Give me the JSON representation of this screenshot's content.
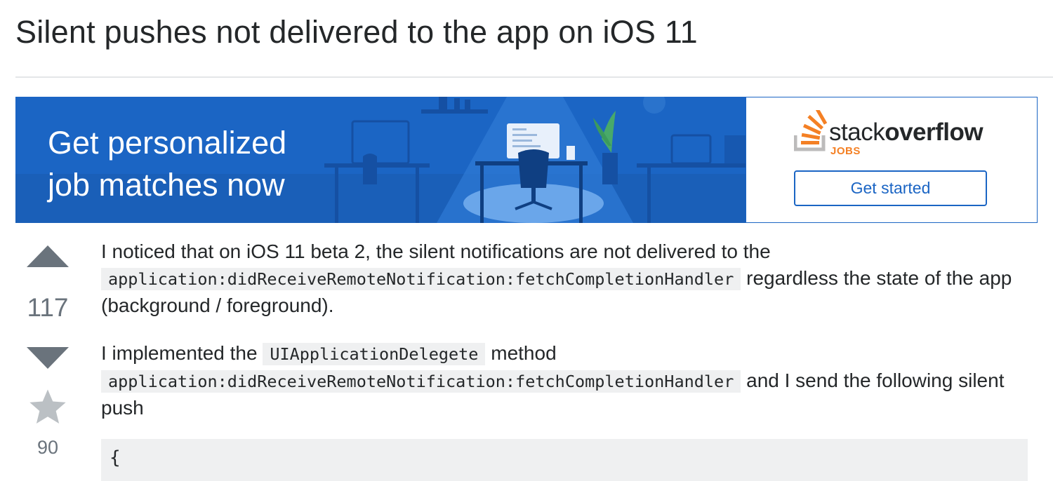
{
  "question": {
    "title": "Silent pushes not delivered to the app on iOS 11"
  },
  "ad": {
    "headline_line1": "Get personalized",
    "headline_line2": "job matches now",
    "brand_stack": "stack",
    "brand_overflow": "overflow",
    "brand_jobs": "JOBS",
    "cta_label": "Get started",
    "colors": {
      "banner_blue": "#1b65c4",
      "brand_orange": "#f48024"
    },
    "icons": [
      "stackoverflow-logo-icon"
    ]
  },
  "votes": {
    "score": "117",
    "favorites": "90",
    "icons": [
      "upvote-arrow-icon",
      "downvote-arrow-icon",
      "favorite-star-icon"
    ]
  },
  "body": {
    "p1_text1": "I noticed that on iOS 11 beta 2, the silent notifications are not delivered to the ",
    "p1_code1": "application:didReceiveRemoteNotification:fetchCompletionHandler",
    "p1_text2": " regardless the state of the app (background / foreground).",
    "p2_text1": "I implemented the ",
    "p2_code1": "UIApplicationDelegete",
    "p2_text2": " method ",
    "p2_code2": "application:didReceiveRemoteNotification:fetchCompletionHandler",
    "p2_text3": " and I send the following silent push",
    "codeblock_first_line": "{"
  }
}
